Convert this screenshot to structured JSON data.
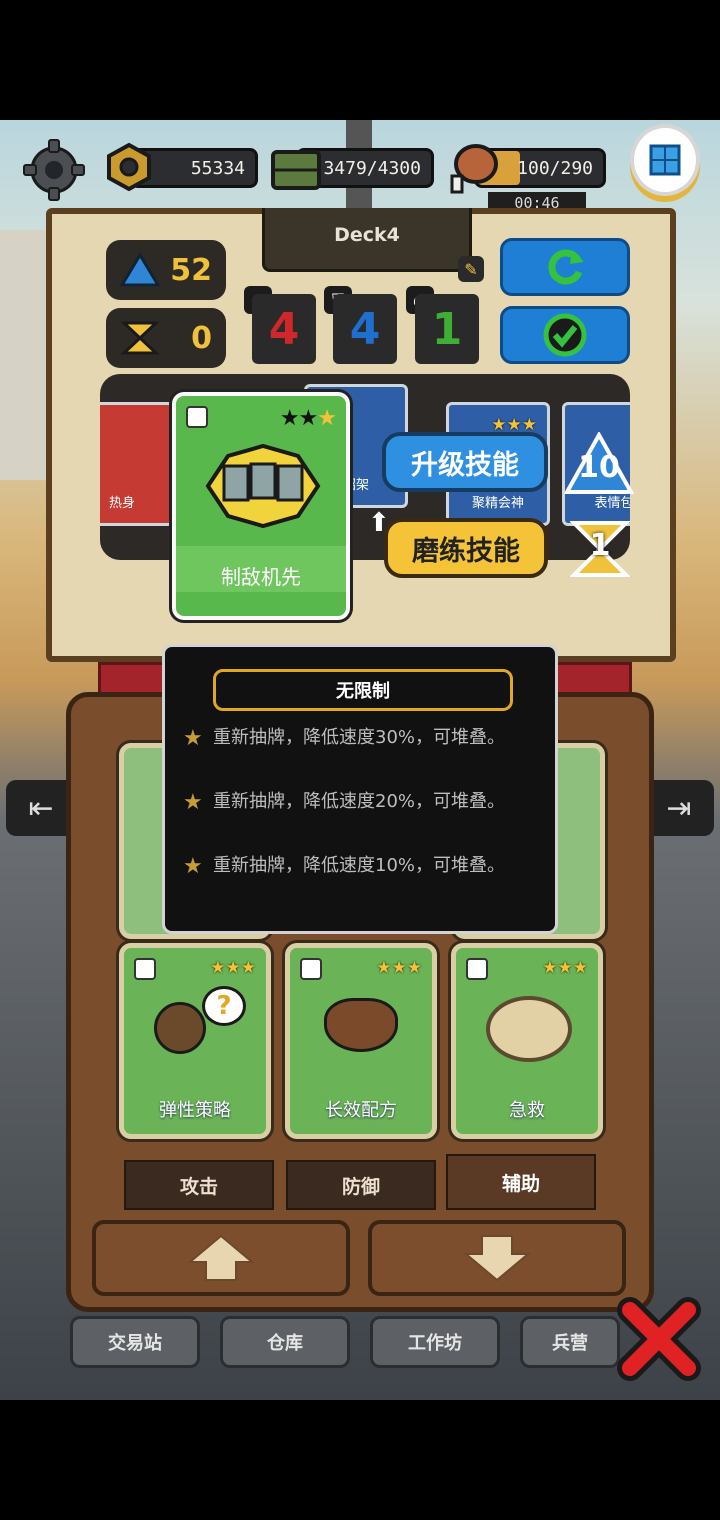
{
  "resources": {
    "coins": "55334",
    "supplies": "3479/4300",
    "food": "100/290",
    "food_fill": 0.34,
    "timer": "00:46"
  },
  "deck": {
    "name": "Deck4",
    "power": "52",
    "cost": "0",
    "attack_count": "4",
    "defense_count": "4",
    "support_count": "1"
  },
  "strip_cards": [
    {
      "label": "热身"
    },
    {
      "label": "招架"
    },
    {
      "label": "聚精会神"
    },
    {
      "label": "表情包"
    }
  ],
  "selected_card": {
    "label": "制敌机先",
    "stars": 3,
    "stars_filled": 1
  },
  "actions": {
    "upgrade_label": "升级技能",
    "upgrade_cost": "10",
    "train_label": "磨练技能",
    "train_cost": "1"
  },
  "tooltip": {
    "title": "无限制",
    "effects": [
      "重新抽牌，降低速度30%，可堆叠。",
      "重新抽牌，降低速度20%，可堆叠。",
      "重新抽牌，降低速度10%，可堆叠。"
    ]
  },
  "deck_cards": [
    {
      "label": "弹性策略"
    },
    {
      "label": "长效配方"
    },
    {
      "label": "急救"
    }
  ],
  "tabs": [
    {
      "label": "攻击"
    },
    {
      "label": "防御"
    },
    {
      "label": "辅助"
    }
  ],
  "bottom_nav": [
    {
      "label": "交易站"
    },
    {
      "label": "仓库"
    },
    {
      "label": "工作坊"
    },
    {
      "label": "兵营"
    }
  ],
  "icons": {
    "settings": "gear-icon",
    "close": "close-icon",
    "confirm": "check-icon",
    "refresh": "refresh-icon"
  },
  "colors": {
    "attack": "#d0272c",
    "defense": "#1e6fd0",
    "support": "#3fae34",
    "gold": "#f0c23b"
  }
}
